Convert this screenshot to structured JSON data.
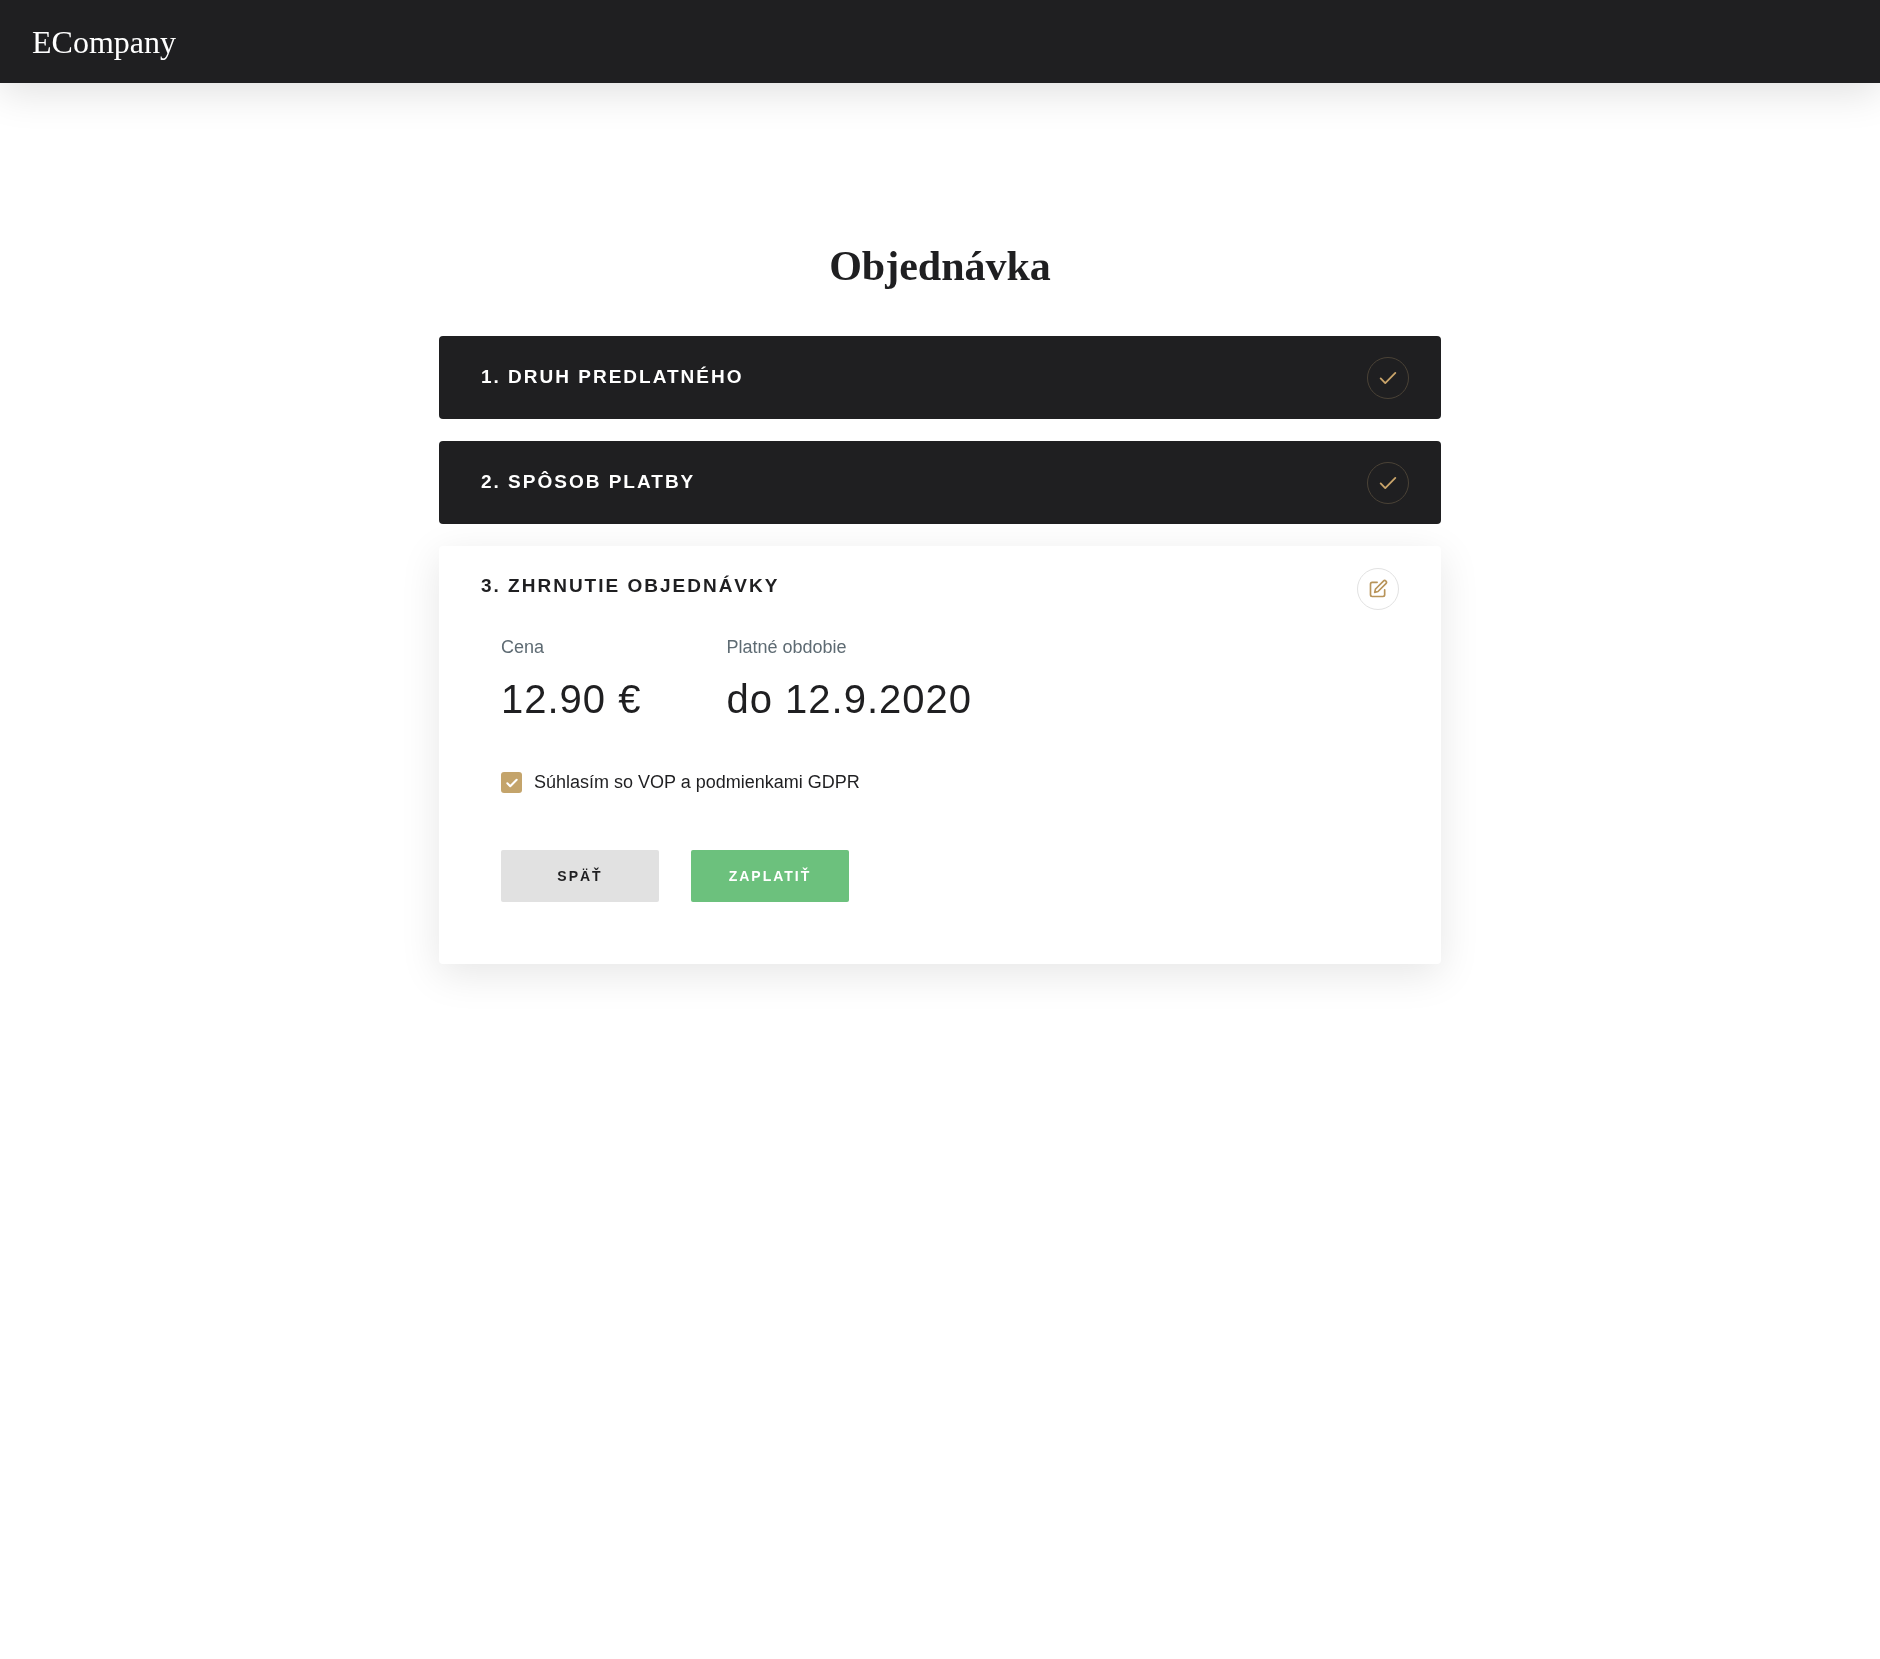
{
  "header": {
    "logo": "ECompany"
  },
  "page_title": "Objednávka",
  "steps": [
    {
      "label": "1. DRUH PREDLATNÉHO",
      "kind": "done",
      "expanded": false
    },
    {
      "label": "2. SPÔSOB PLATBY",
      "kind": "done",
      "expanded": false
    },
    {
      "label": "3. ZHRNUTIE OBJEDNÁVKY",
      "kind": "edit",
      "expanded": true
    }
  ],
  "summary": {
    "fields": [
      {
        "label": "Cena",
        "value": "12.90 €"
      },
      {
        "label": "Platné obdobie",
        "value": "do 12.9.2020"
      }
    ],
    "agreement": {
      "label": "Súhlasím so VOP a podmienkami GDPR",
      "checked": true
    },
    "buttons": [
      {
        "label": "SPÄŤ",
        "kind": "secondary"
      },
      {
        "label": "ZAPLATIŤ",
        "kind": "primary"
      }
    ]
  }
}
